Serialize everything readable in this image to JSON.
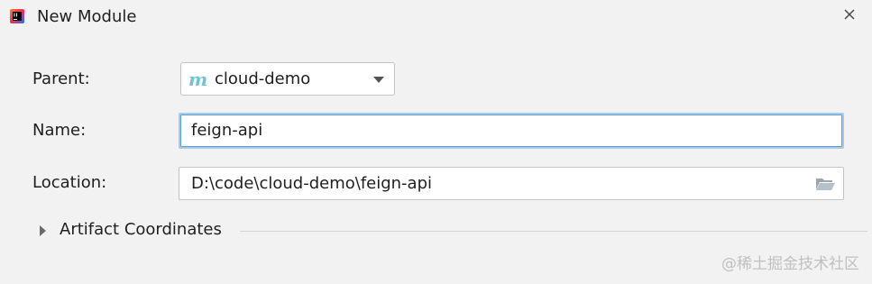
{
  "window": {
    "title": "New Module",
    "app_icon": "intellij-idea-icon",
    "close_icon": "close-icon",
    "close_glyph": "✕"
  },
  "form": {
    "parent": {
      "label": "Parent:",
      "value": "cloud-demo",
      "module_icon": "maven-module-icon",
      "module_icon_glyph": "m"
    },
    "name": {
      "label": "Name:",
      "value": "feign-api"
    },
    "location": {
      "label": "Location:",
      "value": "D:\\code\\cloud-demo\\feign-api",
      "browse_icon": "folder-icon"
    }
  },
  "sections": {
    "artifact_coordinates": {
      "label": "Artifact Coordinates",
      "expanded": false
    }
  },
  "watermark": "@稀土掘金技术社区",
  "colors": {
    "background": "#f2f2f2",
    "focus_border": "#5d9dd3",
    "maven_icon": "#6fc3d3"
  }
}
